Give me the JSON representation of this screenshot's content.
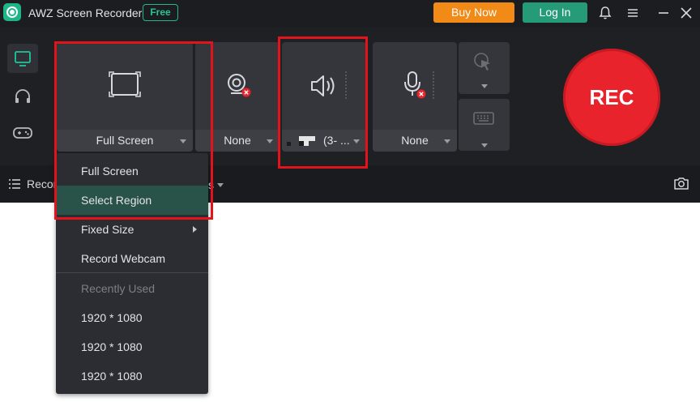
{
  "app": {
    "title": "AWZ Screen Recorder",
    "badge": "Free"
  },
  "header": {
    "buy_label": "Buy Now",
    "login_label": "Log In"
  },
  "tiles": {
    "screen": {
      "label": "Full Screen"
    },
    "webcam": {
      "label": "None"
    },
    "audio": {
      "label": "(3- ..."
    },
    "mic": {
      "label": "None"
    }
  },
  "rec_label": "REC",
  "bottombar": {
    "recordings_label": "Recor"
  },
  "menu": {
    "items": [
      "Full Screen",
      "Select Region",
      "Fixed Size",
      "Record Webcam"
    ],
    "section_label": "Recently Used",
    "recent": [
      "1920 * 1080",
      "1920 * 1080",
      "1920 * 1080"
    ]
  },
  "colors": {
    "accent": "#259b76",
    "rec": "#e8232c",
    "buy": "#f28a17",
    "highlight": "#e0141a"
  }
}
